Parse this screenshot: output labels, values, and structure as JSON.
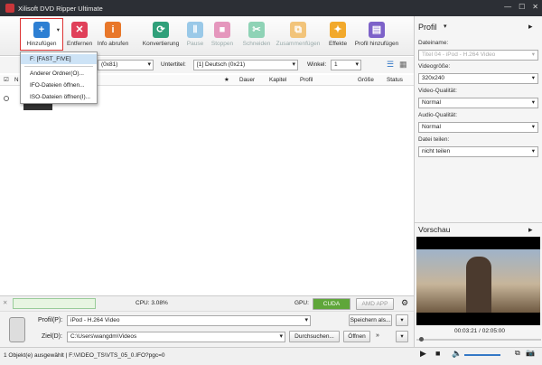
{
  "title": "Xilisoft DVD Ripper Ultimate",
  "toolbar": {
    "add": "Hinzufügen",
    "remove": "Entfernen",
    "info": "Info abrufen",
    "convert": "Konvertierung",
    "pause": "Pause",
    "stop": "Stoppen",
    "cut": "Schneiden",
    "merge": "Zusammenfügen",
    "effects": "Effekte",
    "add_profile": "Profil hinzufügen"
  },
  "menu": {
    "item1": "F: [FAST_FIVE]",
    "item2": "Anderer Ordner(O)...",
    "item3": "IFO-Dateien öffnen...",
    "item4": "ISO-Dateien öffnen(I)..."
  },
  "filter": {
    "audio_value": "(0x81)",
    "subtitle_label": "Untertitel:",
    "subtitle_value": "[1] Deutsch (0x21)",
    "angle_label": "Winkel:",
    "angle_value": "1"
  },
  "columns": {
    "c_n": "N",
    "c_star": "★",
    "c_dauer": "Dauer",
    "c_kapitel": "Kapitel",
    "c_profil": "Profil",
    "c_groesse": "Größe",
    "c_status": "Status"
  },
  "status": {
    "cpu": "CPU: 3.08%",
    "gpu": "GPU:",
    "cuda": "CUDA",
    "amd": "AMD APP"
  },
  "bottom": {
    "profile_label": "Profil(P):",
    "profile_value": "iPod - H.264 Video",
    "save_as": "Speichern als...",
    "dest_label": "Ziel(D):",
    "dest_value": "C:\\Users\\wangdm\\Videos",
    "browse": "Durchsuchen...",
    "open": "Öffnen"
  },
  "footer": {
    "text": "1 Objekt(e) ausgewählt | F:\\VIDEO_TS\\VTS_05_0.IFO?pgc=0"
  },
  "right": {
    "title": "Profil",
    "filename_label": "Dateiname:",
    "filename_value": "Titel 04 - iPod - H.264 Video",
    "videosize_label": "Videogröße:",
    "videosize_value": "320x240",
    "vq_label": "Video-Qualität:",
    "vq_value": "Normal",
    "aq_label": "Audio-Qualität:",
    "aq_value": "Normal",
    "split_label": "Datei teilen:",
    "split_value": "nicht teilen",
    "preview": "Vorschau",
    "time": "00:03:21 / 02:05:00"
  }
}
